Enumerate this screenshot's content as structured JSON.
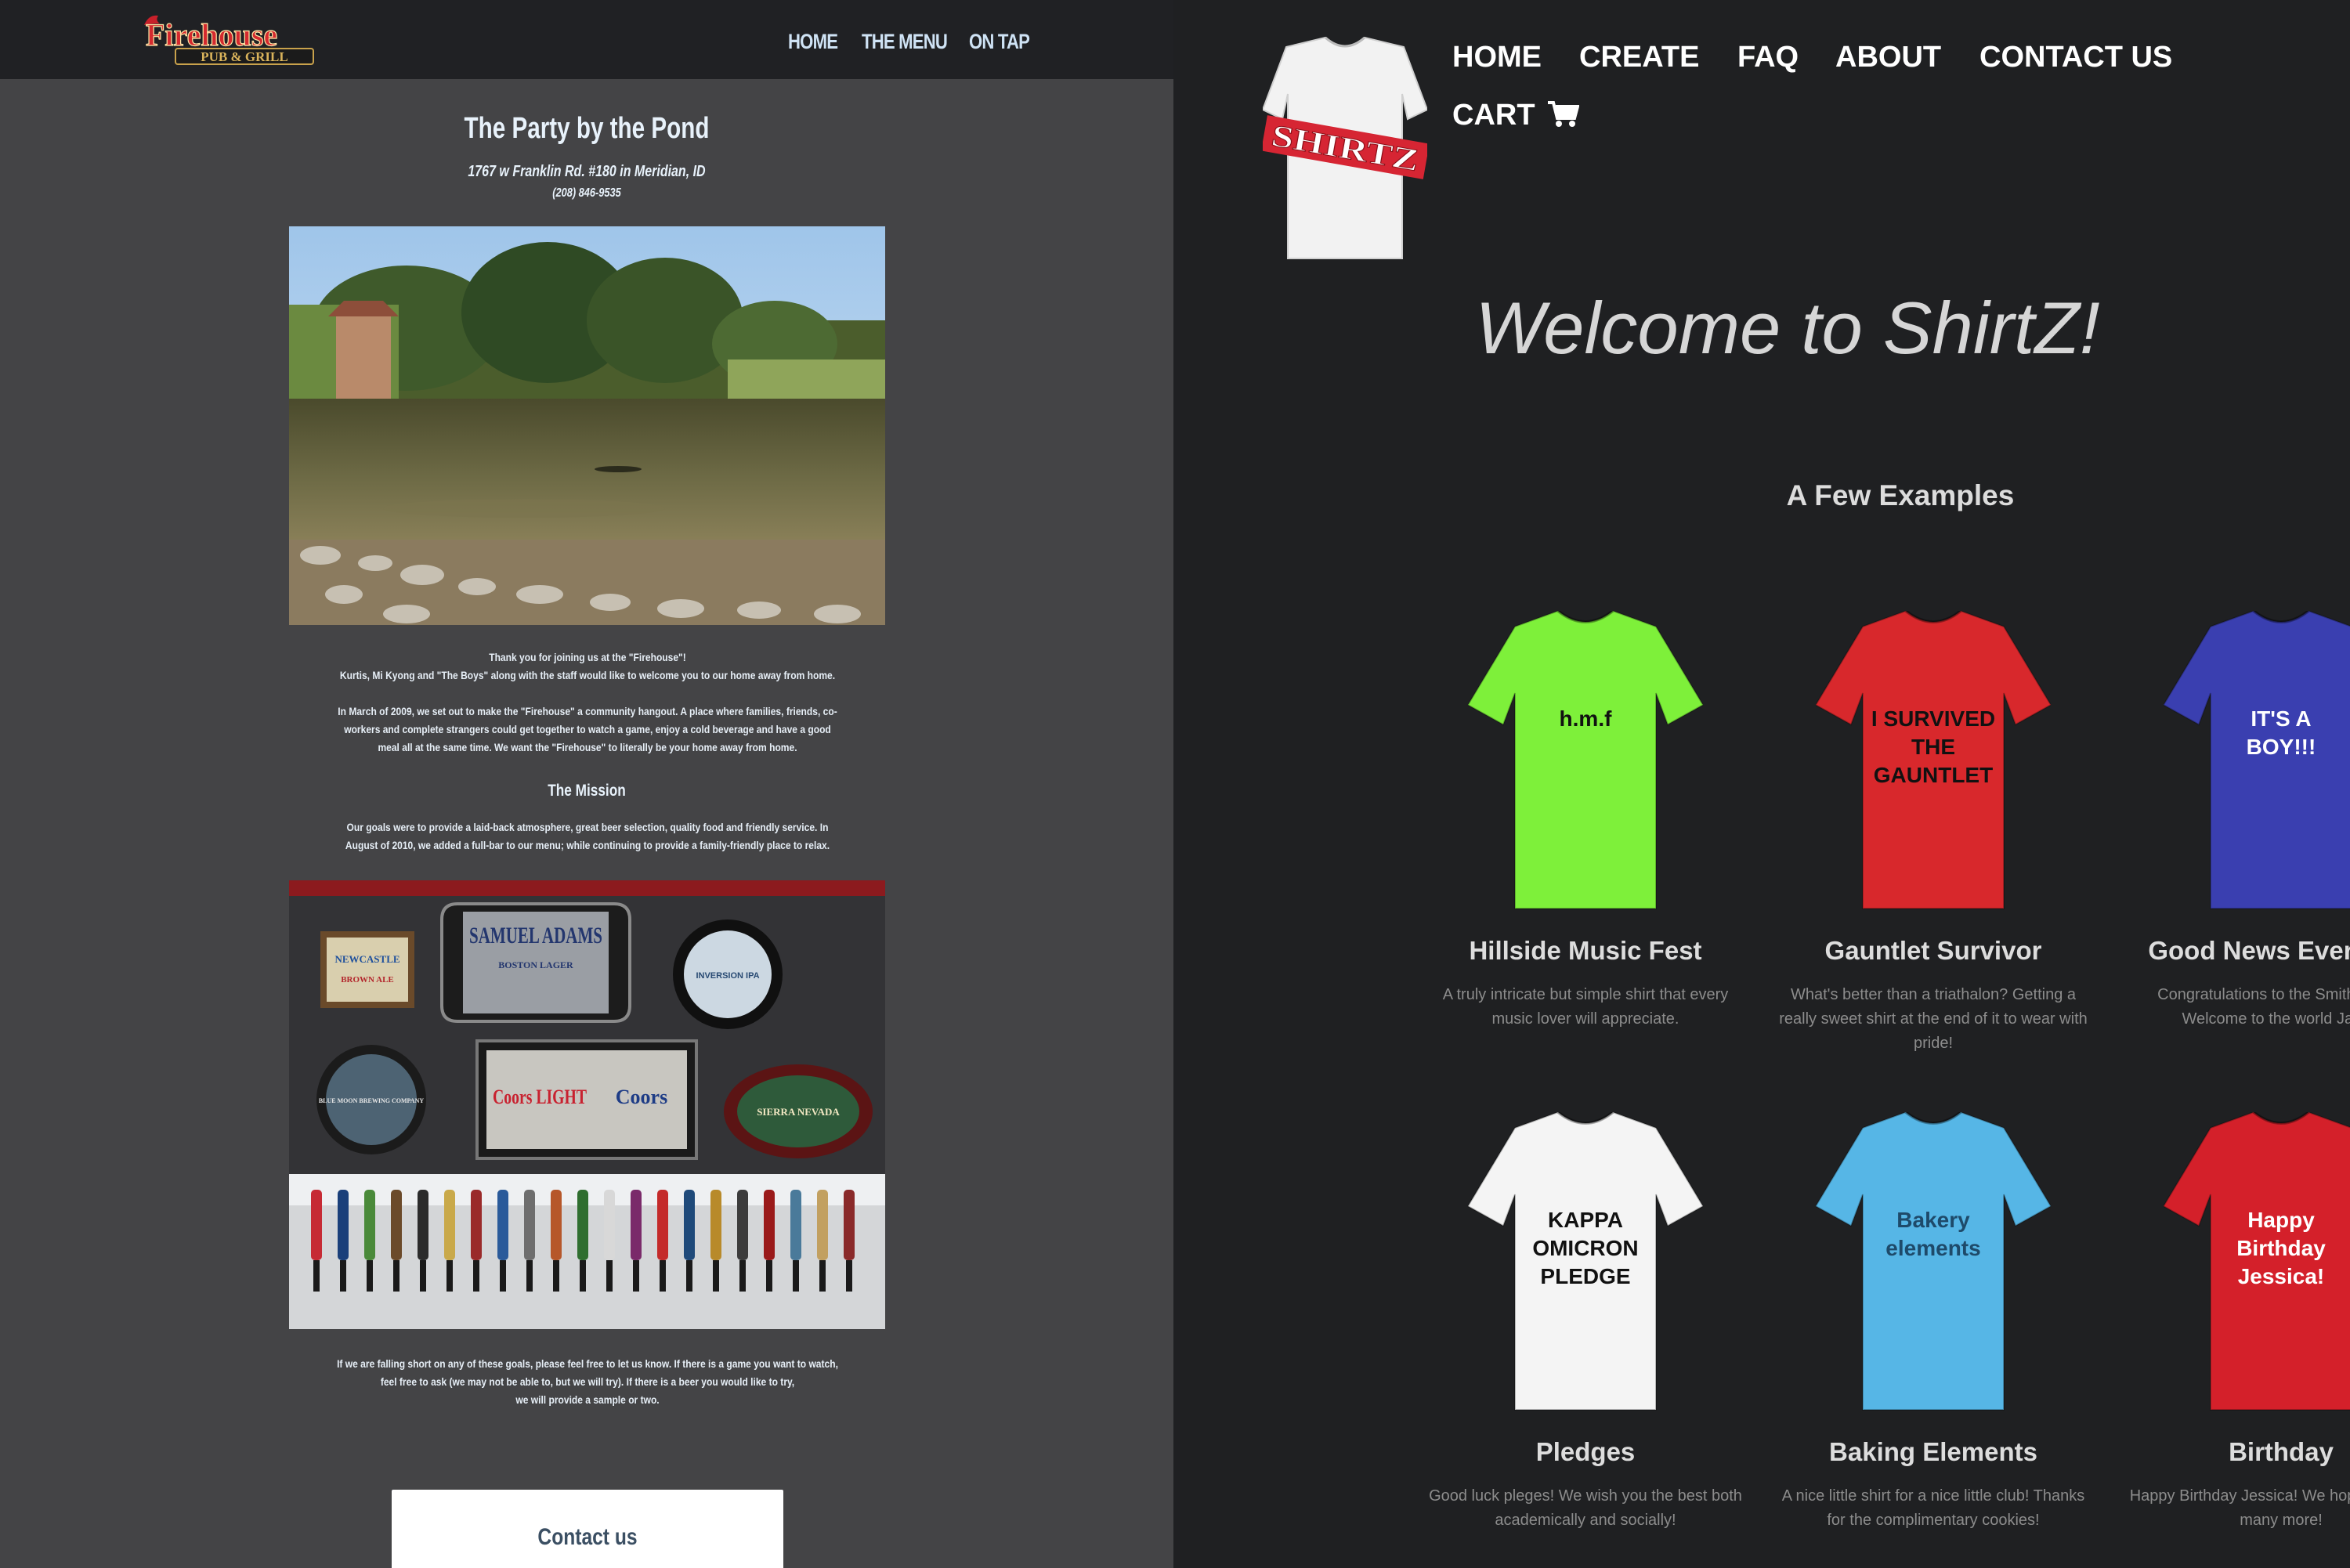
{
  "firehouse": {
    "logo": {
      "title": "Firehouse",
      "subtitle": "PUB & GRILL"
    },
    "nav": [
      "HOME",
      "THE MENU",
      "ON TAP"
    ],
    "heading": "The Party by the Pond",
    "address": "1767 w Franklin Rd. #180 in Meridian, ID",
    "phone": "(208) 846-9535",
    "welcome_lines": [
      "Thank you for joining us at the \"Firehouse\"!",
      "Kurtis, Mi Kyong and \"The Boys\" along with the staff would like to welcome you to our home away from home."
    ],
    "story_lines": [
      "In March of 2009, we set out to make the \"Firehouse\" a community hangout. A place where families, friends, co-",
      "workers and complete strangers could get together to watch a game, enjoy a cold beverage and have a good",
      "meal all at the same time. We want the \"Firehouse\" to literally be your home away from home."
    ],
    "mission_heading": "The Mission",
    "mission_lines": [
      "Our goals were to provide a laid-back atmosphere, great beer selection, quality food and friendly service. In",
      "August of 2010, we added a full-bar to our menu; while continuing to provide a family-friendly place to relax."
    ],
    "closing_lines": [
      "If we are falling short on any of these goals, please feel free to let us know. If there is a game you want to watch,",
      "feel free to ask (we may not be able to, but we will try). If there is a beer you would like to try,",
      "we will provide a sample or two."
    ],
    "contact_button": "Contact us",
    "sign_labels": {
      "samuel": "SAMUEL ADAMS",
      "samuel_sub": "BOSTON LAGER",
      "newcastle": "NEWCASTLE",
      "newcastle_sub": "BROWN ALE",
      "coors_light": "Coors LIGHT",
      "coors": "Coors",
      "inversion": "INVERSION IPA",
      "bluemoon": "BLUE MOON BREWING COMPANY",
      "sierra": "SIERRA NEVADA"
    }
  },
  "shirtz": {
    "logo_text": "SHIRTZ",
    "nav": {
      "home": "HOME",
      "create": "CREATE",
      "faq": "FAQ",
      "about": "ABOUT",
      "contact": "CONTACT US",
      "cart": "CART"
    },
    "welcome": "Welcome to ShirtZ!",
    "examples_title": "A Few Examples",
    "examples": [
      {
        "title": "Hillside Music Fest",
        "desc": "A truly intricate but simple shirt that every music lover will appreciate.",
        "shirt_text": "h.m.f",
        "color": "#7ef03a"
      },
      {
        "title": "Gauntlet Survivor",
        "desc": "What's better than a triathalon? Getting a really sweet shirt at the end of it to wear with pride!",
        "shirt_text": "I SURVIVED THE GAUNTLET",
        "color": "#d8282c"
      },
      {
        "title": "Good News Everyone",
        "desc": "Congratulations to the Smith family! Welcome to the world Jared!",
        "shirt_text": "IT'S A BOY!!!",
        "color": "#3a3fb0"
      },
      {
        "title": "Pledges",
        "desc": "Good luck pleges! We wish you the best both academically and socially!",
        "shirt_text": "KAPPA OMICRON PLEDGE",
        "color": "#f4f4f4"
      },
      {
        "title": "Baking Elements",
        "desc": "A nice little shirt for a nice little club! Thanks for the complimentary cookies!",
        "shirt_text": "Bakery elements",
        "color": "#56b6e6"
      },
      {
        "title": "Birthday",
        "desc": "Happy Birthday Jessica! We hope you have many more!",
        "shirt_text": "Happy Birthday Jessica!",
        "color": "#d4202a"
      }
    ]
  }
}
